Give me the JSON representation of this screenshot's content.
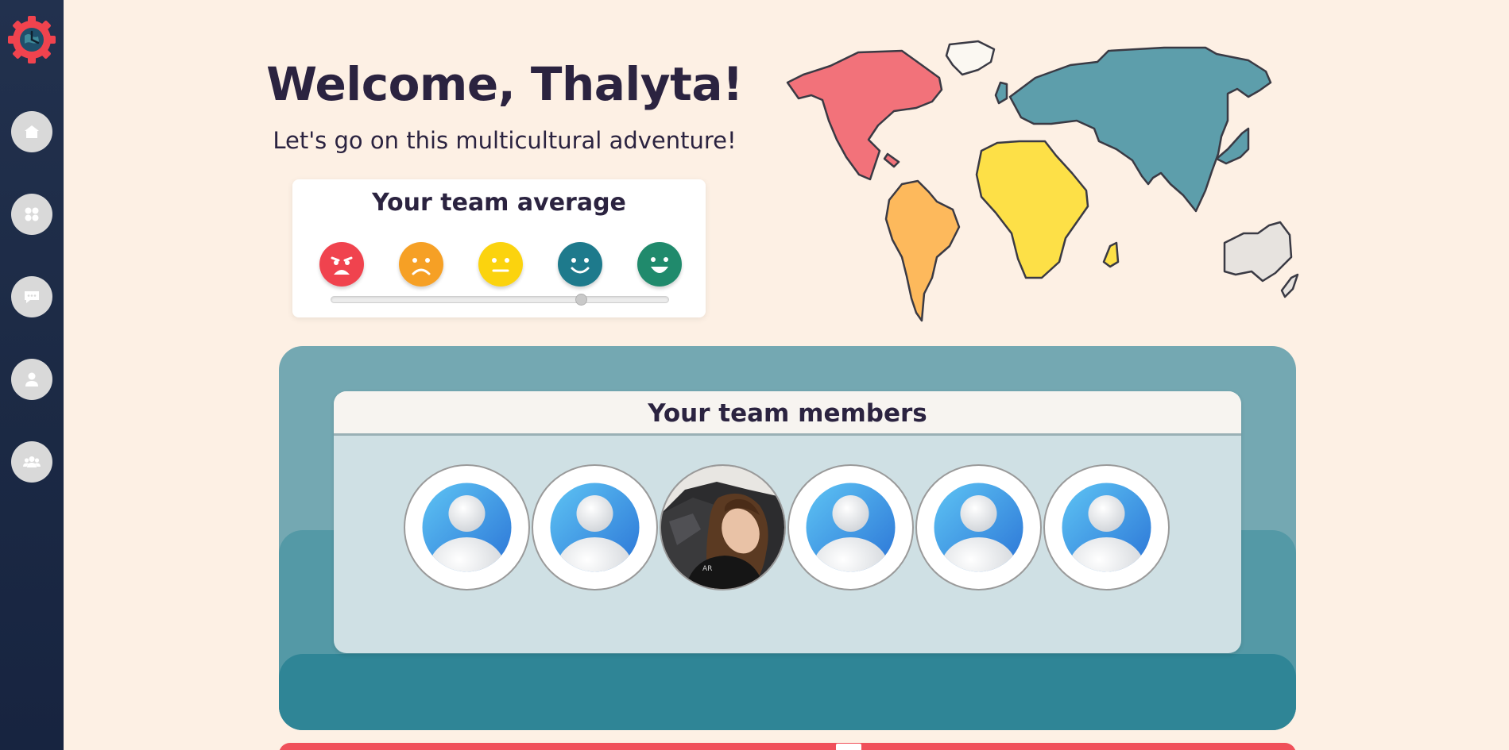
{
  "app": {
    "logo_icon": "gear-clock-logo-icon",
    "colors": {
      "background": "#fdf0e4",
      "sidebar": "#1c2a45",
      "text": "#2b2340",
      "accent_red": "#f0505a",
      "teal": "#2f8596"
    }
  },
  "sidebar": {
    "items": [
      {
        "icon": "home-icon"
      },
      {
        "icon": "dashboard-icon"
      },
      {
        "icon": "chat-icon"
      },
      {
        "icon": "profile-icon"
      },
      {
        "icon": "team-icon"
      }
    ]
  },
  "hero": {
    "title": "Welcome, Thalyta!",
    "subtitle": "Let's go on this multicultural adventure!"
  },
  "team_average": {
    "title": "Your team average",
    "moods": [
      {
        "icon": "very-sad-face-icon",
        "color": "#f0434e"
      },
      {
        "icon": "sad-face-icon",
        "color": "#f6a025"
      },
      {
        "icon": "neutral-face-icon",
        "color": "#fbd30e"
      },
      {
        "icon": "happy-face-icon",
        "color": "#1e7a8c"
      },
      {
        "icon": "very-happy-face-icon",
        "color": "#208a6c"
      }
    ],
    "average_fraction": 0.74
  },
  "world_map": {
    "icon": "world-map-illustration",
    "continent_colors": {
      "north_america": "#f2727a",
      "south_america": "#fdb95c",
      "europe_greenland": "#fbf8f2",
      "africa": "#fde047",
      "asia": "#5d9eab",
      "oceania": "#e7e3df"
    }
  },
  "team": {
    "title": "Your team members",
    "members": [
      {
        "type": "default-avatar-icon"
      },
      {
        "type": "default-avatar-icon"
      },
      {
        "type": "photo-avatar"
      },
      {
        "type": "default-avatar-icon"
      },
      {
        "type": "default-avatar-icon"
      },
      {
        "type": "default-avatar-icon"
      }
    ]
  }
}
